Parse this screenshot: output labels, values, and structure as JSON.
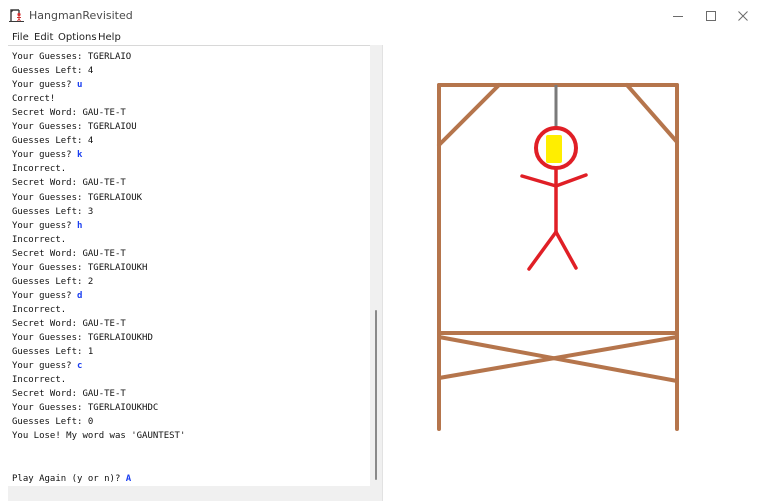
{
  "window": {
    "title": "HangmanRevisited",
    "icon": "hangman-app-icon",
    "controls": [
      "minimize-icon",
      "maximize-icon",
      "close-icon"
    ]
  },
  "menu": {
    "file": "File",
    "edit": "Edit",
    "options": "Options",
    "help": "Help"
  },
  "console": {
    "lines": [
      {
        "text": "Your Guesses: TGERLAIO",
        "input": ""
      },
      {
        "text": "Guesses Left: 4",
        "input": ""
      },
      {
        "text": "Your guess? ",
        "input": "u"
      },
      {
        "text": "Correct!",
        "input": ""
      },
      {
        "text": "Secret Word: GAU-TE-T",
        "input": ""
      },
      {
        "text": "Your Guesses: TGERLAIOU",
        "input": ""
      },
      {
        "text": "Guesses Left: 4",
        "input": ""
      },
      {
        "text": "Your guess? ",
        "input": "k"
      },
      {
        "text": "Incorrect.",
        "input": ""
      },
      {
        "text": "Secret Word: GAU-TE-T",
        "input": ""
      },
      {
        "text": "Your Guesses: TGERLAIOUK",
        "input": ""
      },
      {
        "text": "Guesses Left: 3",
        "input": ""
      },
      {
        "text": "Your guess? ",
        "input": "h"
      },
      {
        "text": "Incorrect.",
        "input": ""
      },
      {
        "text": "Secret Word: GAU-TE-T",
        "input": ""
      },
      {
        "text": "Your Guesses: TGERLAIOUKH",
        "input": ""
      },
      {
        "text": "Guesses Left: 2",
        "input": ""
      },
      {
        "text": "Your guess? ",
        "input": "d"
      },
      {
        "text": "Incorrect.",
        "input": ""
      },
      {
        "text": "Secret Word: GAU-TE-T",
        "input": ""
      },
      {
        "text": "Your Guesses: TGERLAIOUKHD",
        "input": ""
      },
      {
        "text": "Guesses Left: 1",
        "input": ""
      },
      {
        "text": "Your guess? ",
        "input": "c"
      },
      {
        "text": "Incorrect.",
        "input": ""
      },
      {
        "text": "Secret Word: GAU-TE-T",
        "input": ""
      },
      {
        "text": "Your Guesses: TGERLAIOUKHDC",
        "input": ""
      },
      {
        "text": "Guesses Left: 0",
        "input": ""
      },
      {
        "text": "You Lose! My word was 'GAUNTEST'",
        "input": ""
      },
      {
        "text": "",
        "input": ""
      },
      {
        "text": "",
        "input": ""
      },
      {
        "text": "Play Again (y or n)? ",
        "input": "A"
      }
    ]
  },
  "colors": {
    "gallows": "#b5754c",
    "rope": "#7a7a7a",
    "figure": "#e01f26",
    "face": "#ffee00",
    "input_text": "#1a3ef0"
  }
}
